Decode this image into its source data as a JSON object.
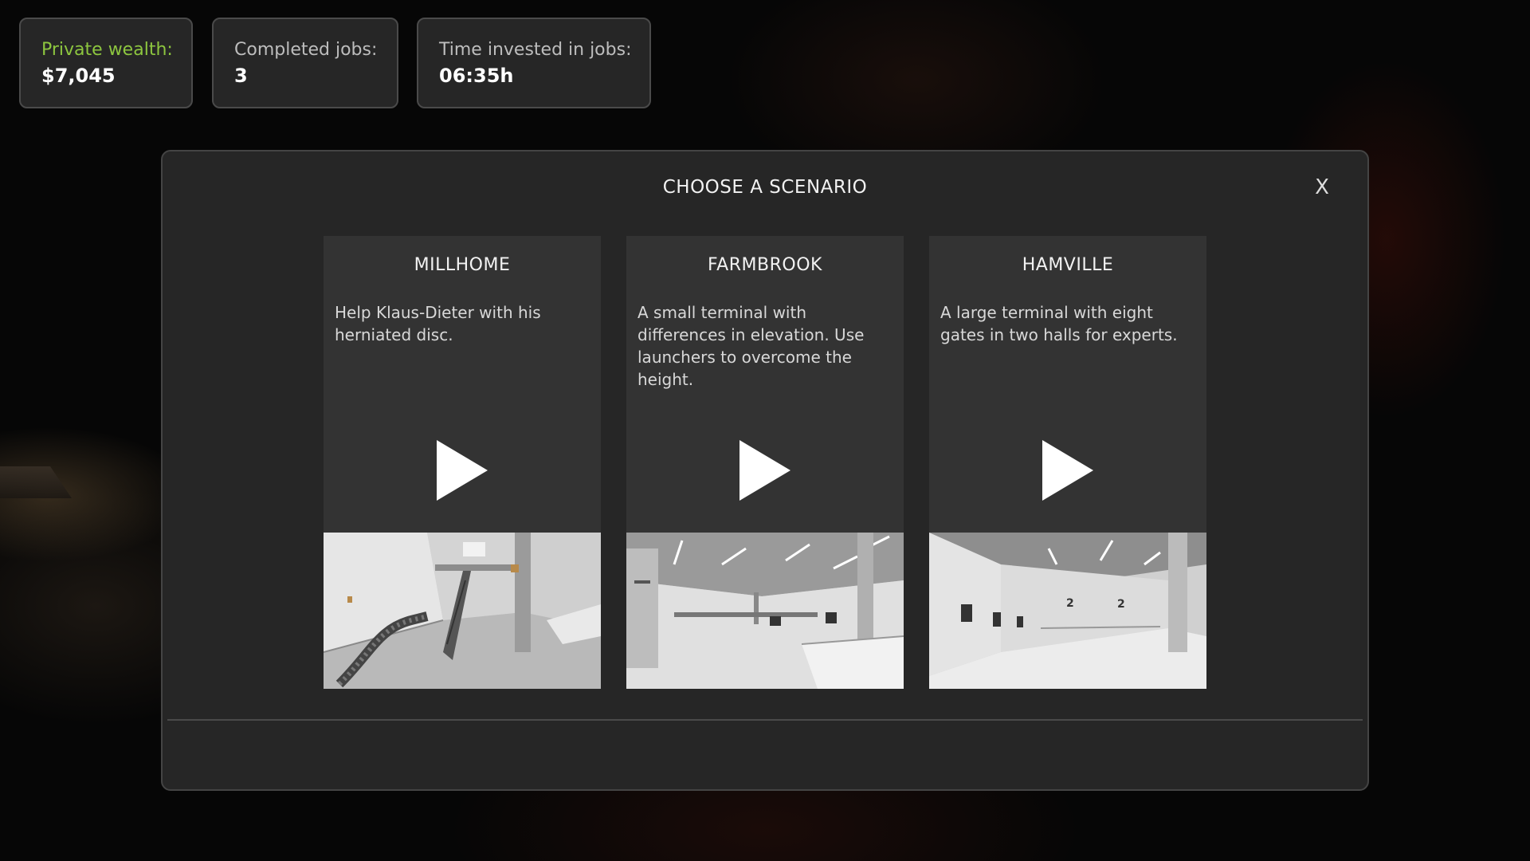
{
  "stats": {
    "wealth": {
      "label": "Private wealth:",
      "value": "$7,045",
      "label_color": "#8dc63f"
    },
    "jobs": {
      "label": "Completed jobs:",
      "value": "3"
    },
    "time": {
      "label": "Time invested in jobs:",
      "value": "06:35h"
    }
  },
  "modal": {
    "title": "CHOOSE A SCENARIO",
    "close_label": "X"
  },
  "scenarios": [
    {
      "name": "MILLHOME",
      "description": "Help Klaus-Dieter with his herniated disc.",
      "icon": "play-icon"
    },
    {
      "name": "FARMBROOK",
      "description": "A small terminal with differences in elevation. Use launchers to overcome the height.",
      "icon": "play-icon"
    },
    {
      "name": "HAMVILLE",
      "description": "A large terminal with eight gates in two halls for experts.",
      "icon": "play-icon",
      "preview_labels": [
        "2",
        "2"
      ]
    }
  ]
}
